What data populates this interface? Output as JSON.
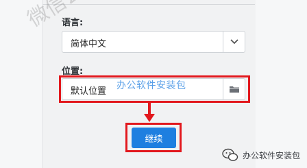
{
  "form": {
    "language_label": "语言:",
    "language_value": "简体中文",
    "location_label": "位置:",
    "location_value": "默认位置"
  },
  "overlay": {
    "text": "办公软件安装包",
    "watermark": "微信公众号"
  },
  "actions": {
    "continue_label": "继续"
  },
  "footer": {
    "brand": "办公软件安装包"
  },
  "icons": {
    "language_dropdown": "chevron-down-icon",
    "location_browse": "folder-icon",
    "arrow": "arrow-down-icon",
    "brand_logo": "wechat-logo-icon"
  },
  "colors": {
    "highlight": "#e2181d",
    "primary_button": "#1e7fe0",
    "overlay_text": "#5aa0e8"
  }
}
